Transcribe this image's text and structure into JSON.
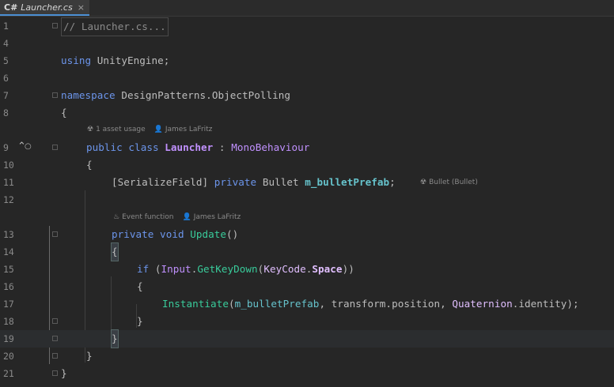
{
  "tab": {
    "lang": "C#",
    "filename": "Launcher.cs",
    "close": "×"
  },
  "lines": {
    "n1": "1",
    "n4": "4",
    "n5": "5",
    "n6": "6",
    "n7": "7",
    "n8": "8",
    "n9": "9",
    "n10": "10",
    "n11": "11",
    "n12": "12",
    "n13": "13",
    "n14": "14",
    "n15": "15",
    "n16": "16",
    "n17": "17",
    "n18": "18",
    "n19": "19",
    "n20": "20",
    "n21": "21"
  },
  "code": {
    "l1": "// Launcher.cs...",
    "l5_kw": "using",
    "l5_ns": " UnityEngine;",
    "l7_kw": "namespace",
    "l7_ns": " DesignPatterns.ObjectPolling",
    "l8": "{",
    "l9_kw": "public class ",
    "l9_cls": "Launcher",
    "l9_sep": " : ",
    "l9_base": "MonoBehaviour",
    "l10": "{",
    "l11_attr": "[SerializeField]",
    "l11_kw": " private ",
    "l11_type": "Bullet",
    "l11_sp": " ",
    "l11_field": "m_bulletPrefab",
    "l11_semi": ";",
    "l13_kw": "private void ",
    "l13_meth": "Update",
    "l13_par": "()",
    "l14": "{",
    "l15_kw": "if",
    "l15_p1": " (",
    "l15_cls": "Input",
    "l15_dot": ".",
    "l15_meth": "GetKeyDown",
    "l15_p2": "(",
    "l15_enum": "KeyCode",
    "l15_dot2": ".",
    "l15_val": "Space",
    "l15_p3": "))",
    "l16": "{",
    "l17_meth": "Instantiate",
    "l17_p1": "(",
    "l17_f1": "m_bulletPrefab",
    "l17_c1": ", ",
    "l17_f2": "transform",
    "l17_dot": ".",
    "l17_f3": "position",
    "l17_c2": ", ",
    "l17_struct": "Quaternion",
    "l17_dot2": ".",
    "l17_f4": "identity",
    "l17_end": ");",
    "l18": "}",
    "l19": "}",
    "l20": "}",
    "l21": "}"
  },
  "hints": {
    "usage": "1 asset usage",
    "author1": "James LaFritz",
    "bullet": "Bullet (Bullet)",
    "event": "Event function",
    "author2": "James LaFritz"
  },
  "colors": {
    "background": "#262626",
    "keyword": "#6c95eb",
    "class": "#c191ff",
    "method": "#39cc9b",
    "field": "#66c3cc",
    "tab_accent": "#4b8fd3"
  },
  "icons": {
    "unity": "unity-icon",
    "person": "person-icon",
    "event": "flame-icon",
    "override": "implements-icon"
  }
}
